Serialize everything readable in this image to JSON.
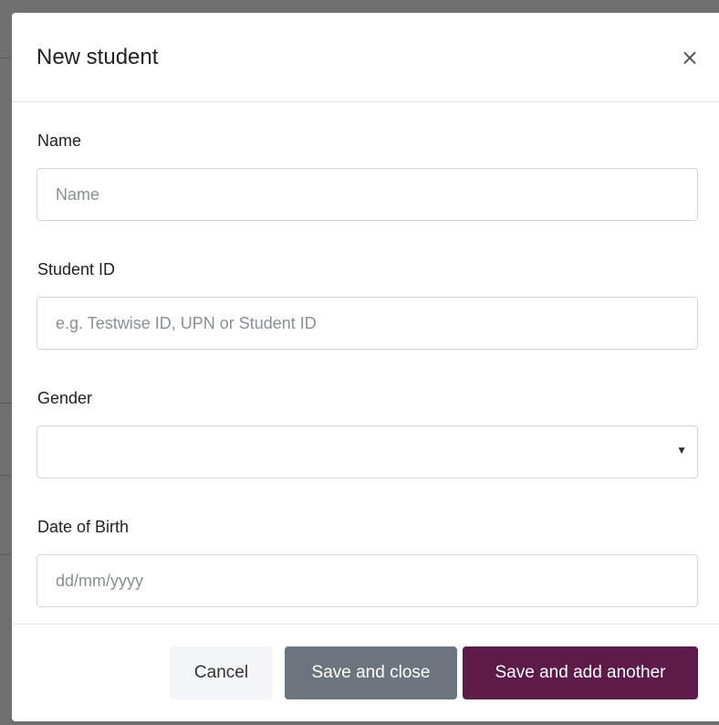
{
  "modal": {
    "title": "New student",
    "close_glyph": "×",
    "fields": {
      "name": {
        "label": "Name",
        "placeholder": "Name",
        "value": ""
      },
      "student_id": {
        "label": "Student ID",
        "placeholder": "e.g. Testwise ID, UPN or Student ID",
        "value": ""
      },
      "gender": {
        "label": "Gender",
        "selected": "",
        "caret": "▼"
      },
      "dob": {
        "label": "Date of Birth",
        "placeholder": "dd/mm/yyyy",
        "value": ""
      }
    },
    "footer": {
      "cancel_label": "Cancel",
      "save_close_label": "Save and close",
      "save_add_label": "Save and add another"
    }
  },
  "colors": {
    "primary_button": "#5e1a48",
    "secondary_button": "#6c757d",
    "backdrop": "#6f6f6f"
  },
  "icons": {
    "close": "close-icon",
    "select_caret": "chevron-down-icon"
  }
}
